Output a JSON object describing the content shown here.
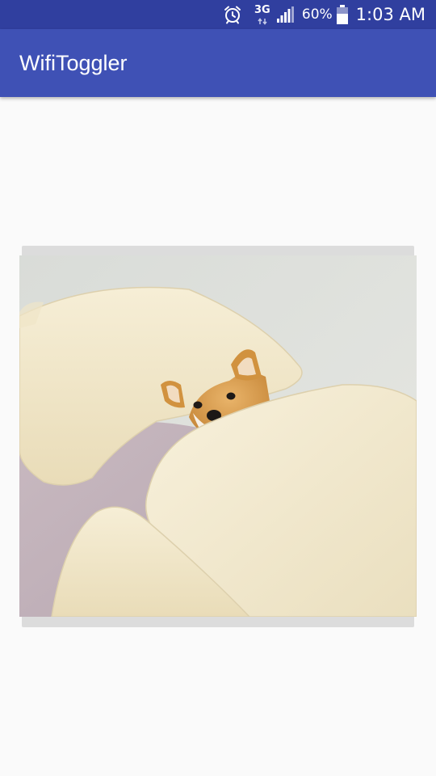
{
  "status_bar": {
    "network_type": "3G",
    "battery_percent": "60%",
    "time": "1:03 AM",
    "icons": [
      "alarm-icon",
      "data-arrows-icon",
      "signal-icon",
      "battery-icon"
    ],
    "background": "#303f9f"
  },
  "app_bar": {
    "title": "WifiToggler",
    "background": "#3f51b5"
  },
  "main": {
    "toggle_image": {
      "subject": "shiba inu dog under cream pillows",
      "state_indicator": "gray card behind image"
    }
  }
}
